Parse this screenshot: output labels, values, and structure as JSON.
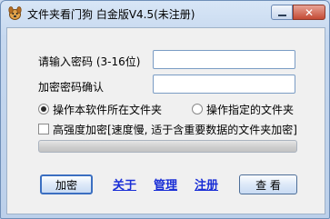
{
  "window": {
    "title": "文件夹看门狗 白金版V4.5(未注册)",
    "minimize_glyph": "—",
    "close_glyph": "✕"
  },
  "form": {
    "password_label": "请输入密码 (3-16位)",
    "password_value": "",
    "confirm_label": "加密密码确认",
    "confirm_value": ""
  },
  "options": {
    "radio_own_folder": "操作本软件所在文件夹",
    "radio_own_folder_selected": true,
    "radio_specified_folder": "操作指定的文件夹",
    "radio_specified_folder_selected": false,
    "high_strength_label": "高强度加密[速度慢, 适于含重要数据的文件夹加密]",
    "high_strength_checked": false,
    "progress": 0
  },
  "actions": {
    "encrypt_button": "加密",
    "about_link": "关于",
    "manage_link": "管理",
    "register_link": "注册",
    "view_button": "查 看"
  },
  "icons": {
    "app": "dog-icon",
    "minimize": "minimize-icon",
    "close": "close-icon"
  },
  "colors": {
    "link": "#1a2fd6",
    "close_button": "#c44a34",
    "client_background": "#f0f0f0"
  }
}
